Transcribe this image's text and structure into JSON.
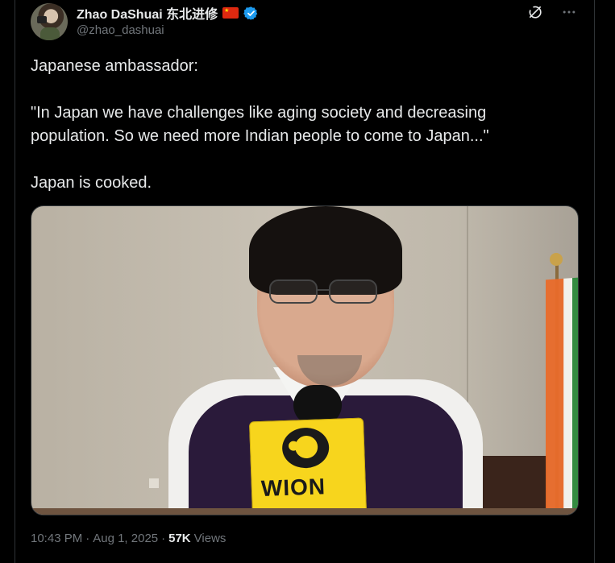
{
  "tweet": {
    "display_name": "Zhao DaShuai 东北进修",
    "handle": "@zhao_dashuai",
    "text_line1": "Japanese ambassador:",
    "text_quote": "\"In Japan we have challenges like aging society and decreasing population. So we need more Indian people to come to Japan...\"",
    "text_line3": "Japan is cooked.",
    "time": "10:43 PM",
    "sep1": "·",
    "date": "Aug 1, 2025",
    "sep2": "·",
    "views_count": "57K",
    "views_label": "Views"
  },
  "media": {
    "logo_text": "WION"
  },
  "icons": {
    "flag": "china-flag-icon",
    "verified": "verified-badge-icon",
    "grok": "grok-icon",
    "more": "more-icon"
  },
  "colors": {
    "background": "#000000",
    "text_primary": "#e7e9ea",
    "text_secondary": "#71767b",
    "verified_blue": "#1d9bf0",
    "wion_yellow": "#f7d51d"
  }
}
